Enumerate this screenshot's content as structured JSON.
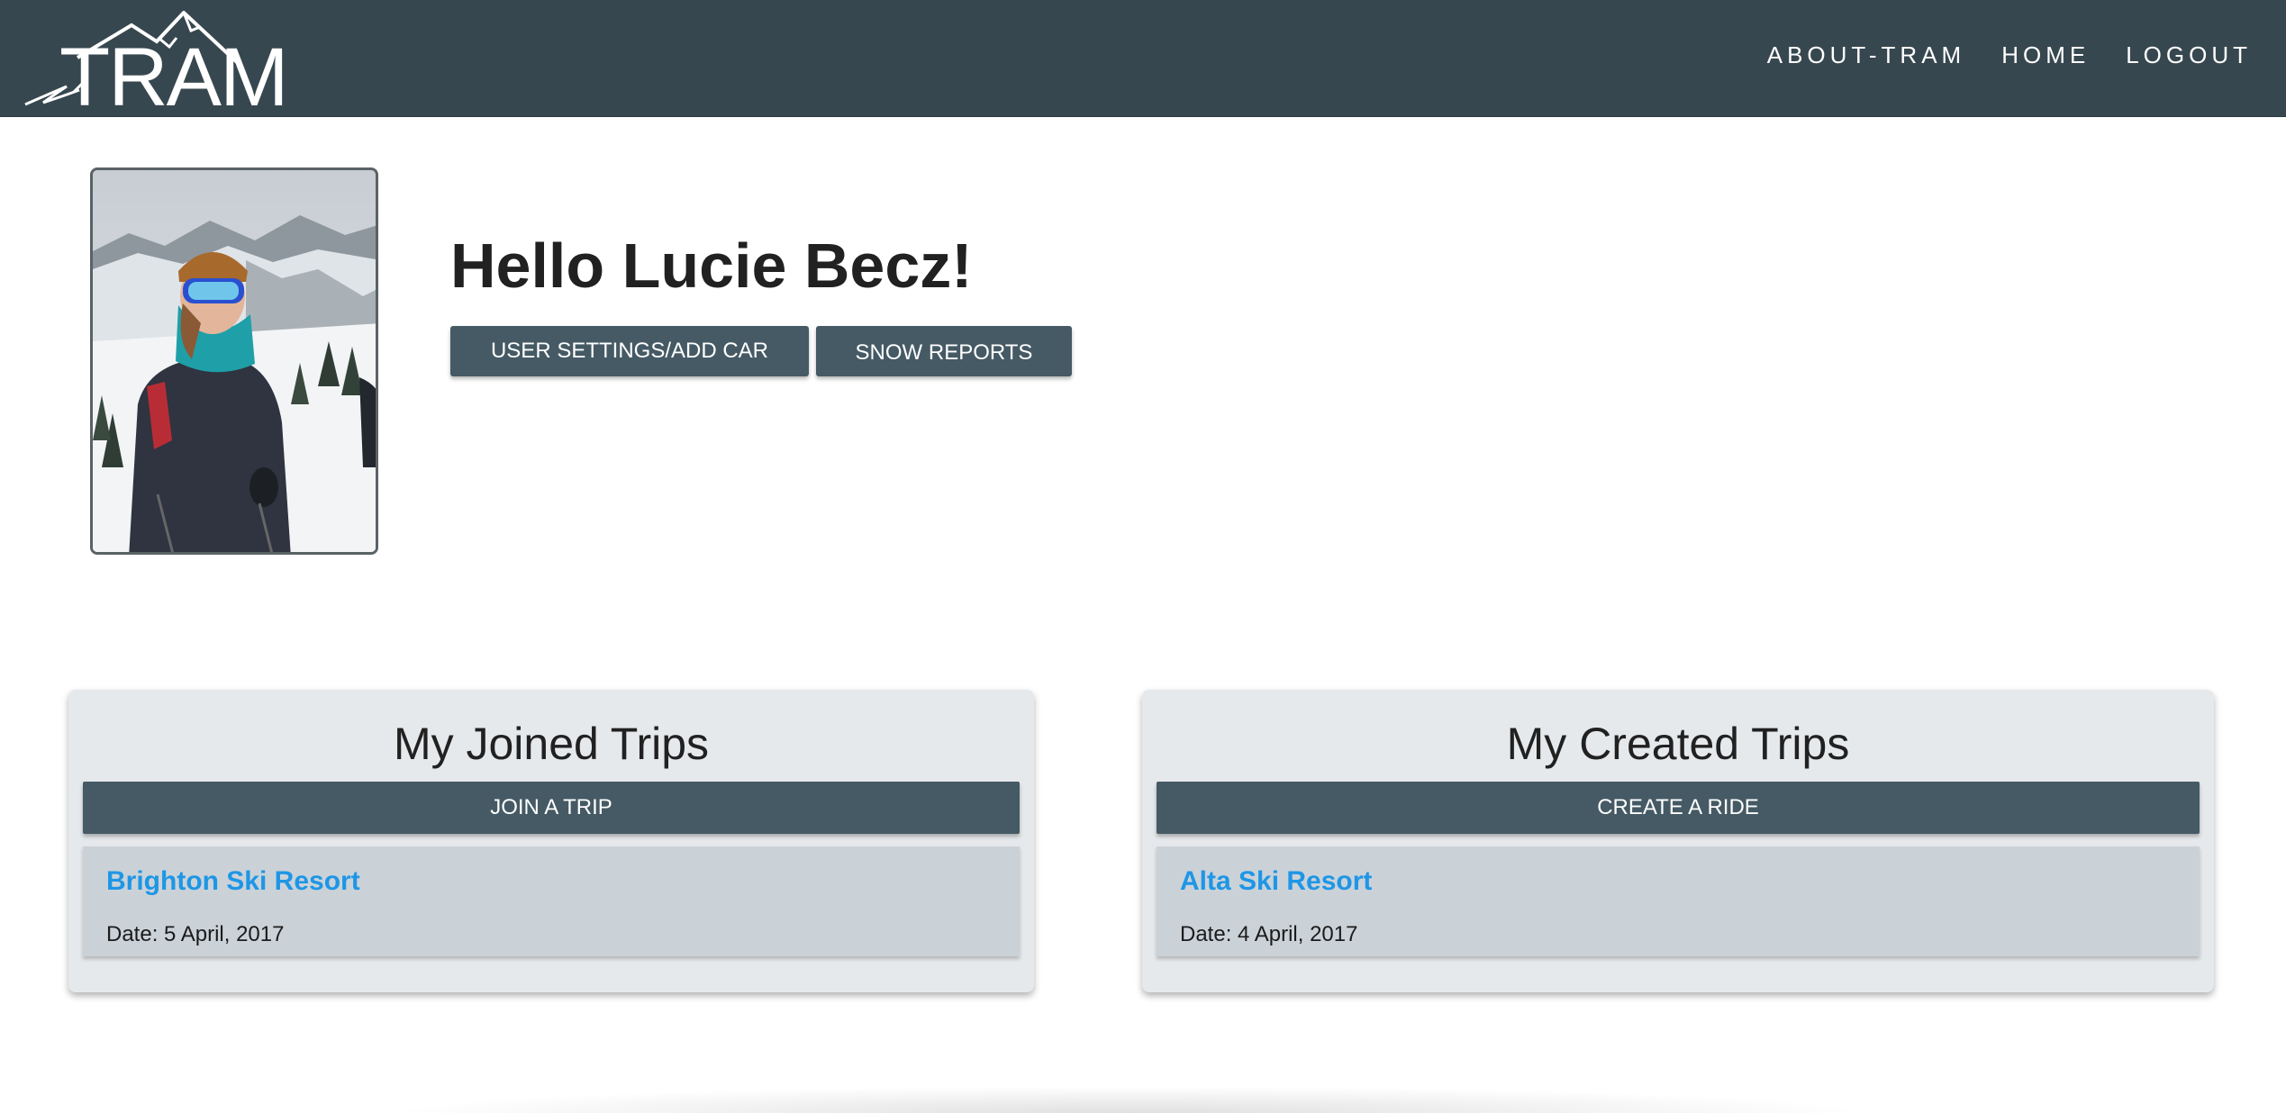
{
  "brand": {
    "logo_text": "TRAM"
  },
  "nav": {
    "items": [
      {
        "label": "ABOUT-TRAM"
      },
      {
        "label": "HOME"
      },
      {
        "label": "LOGOUT"
      }
    ]
  },
  "profile": {
    "greeting": "Hello Lucie Becz!",
    "settings_button": "USER SETTINGS/ADD CAR",
    "snow_button": "SNOW REPORTS"
  },
  "joined": {
    "title": "My Joined Trips",
    "button": "JOIN A TRIP",
    "trips": [
      {
        "name": "Brighton Ski Resort",
        "date": "Date: 5 April, 2017"
      }
    ]
  },
  "created": {
    "title": "My Created Trips",
    "button": "CREATE A RIDE",
    "trips": [
      {
        "name": "Alta Ski Resort",
        "date": "Date: 4 April, 2017"
      }
    ]
  },
  "colors": {
    "navbar": "#37474f",
    "button": "#455a64",
    "card": "#e6e9ec",
    "trip_item": "#cad2d8",
    "link": "#1e96e6"
  }
}
